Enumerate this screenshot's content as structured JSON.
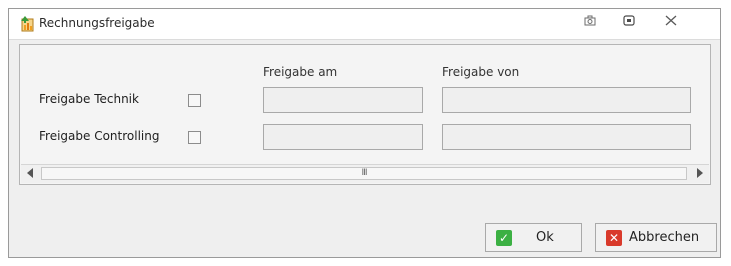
{
  "window": {
    "title": "Rechnungsfreigabe",
    "titlebar_icons": [
      "camera-icon",
      "maximize-icon",
      "close-icon"
    ]
  },
  "columns": {
    "freigabe_am": "Freigabe am",
    "freigabe_von": "Freigabe von"
  },
  "rows": [
    {
      "label": "Freigabe Technik",
      "checked": false,
      "freigabe_am": "",
      "freigabe_von": ""
    },
    {
      "label": "Freigabe Controlling",
      "checked": false,
      "freigabe_am": "",
      "freigabe_von": ""
    }
  ],
  "scrollbar": {
    "grip": "III"
  },
  "buttons": {
    "ok": "Ok",
    "cancel": "Abbrechen"
  },
  "colors": {
    "ok_icon": "#3cb043",
    "cancel_icon": "#d93a2b",
    "app_icon_orange": "#f0a020",
    "app_icon_green": "#3a9a3a"
  }
}
